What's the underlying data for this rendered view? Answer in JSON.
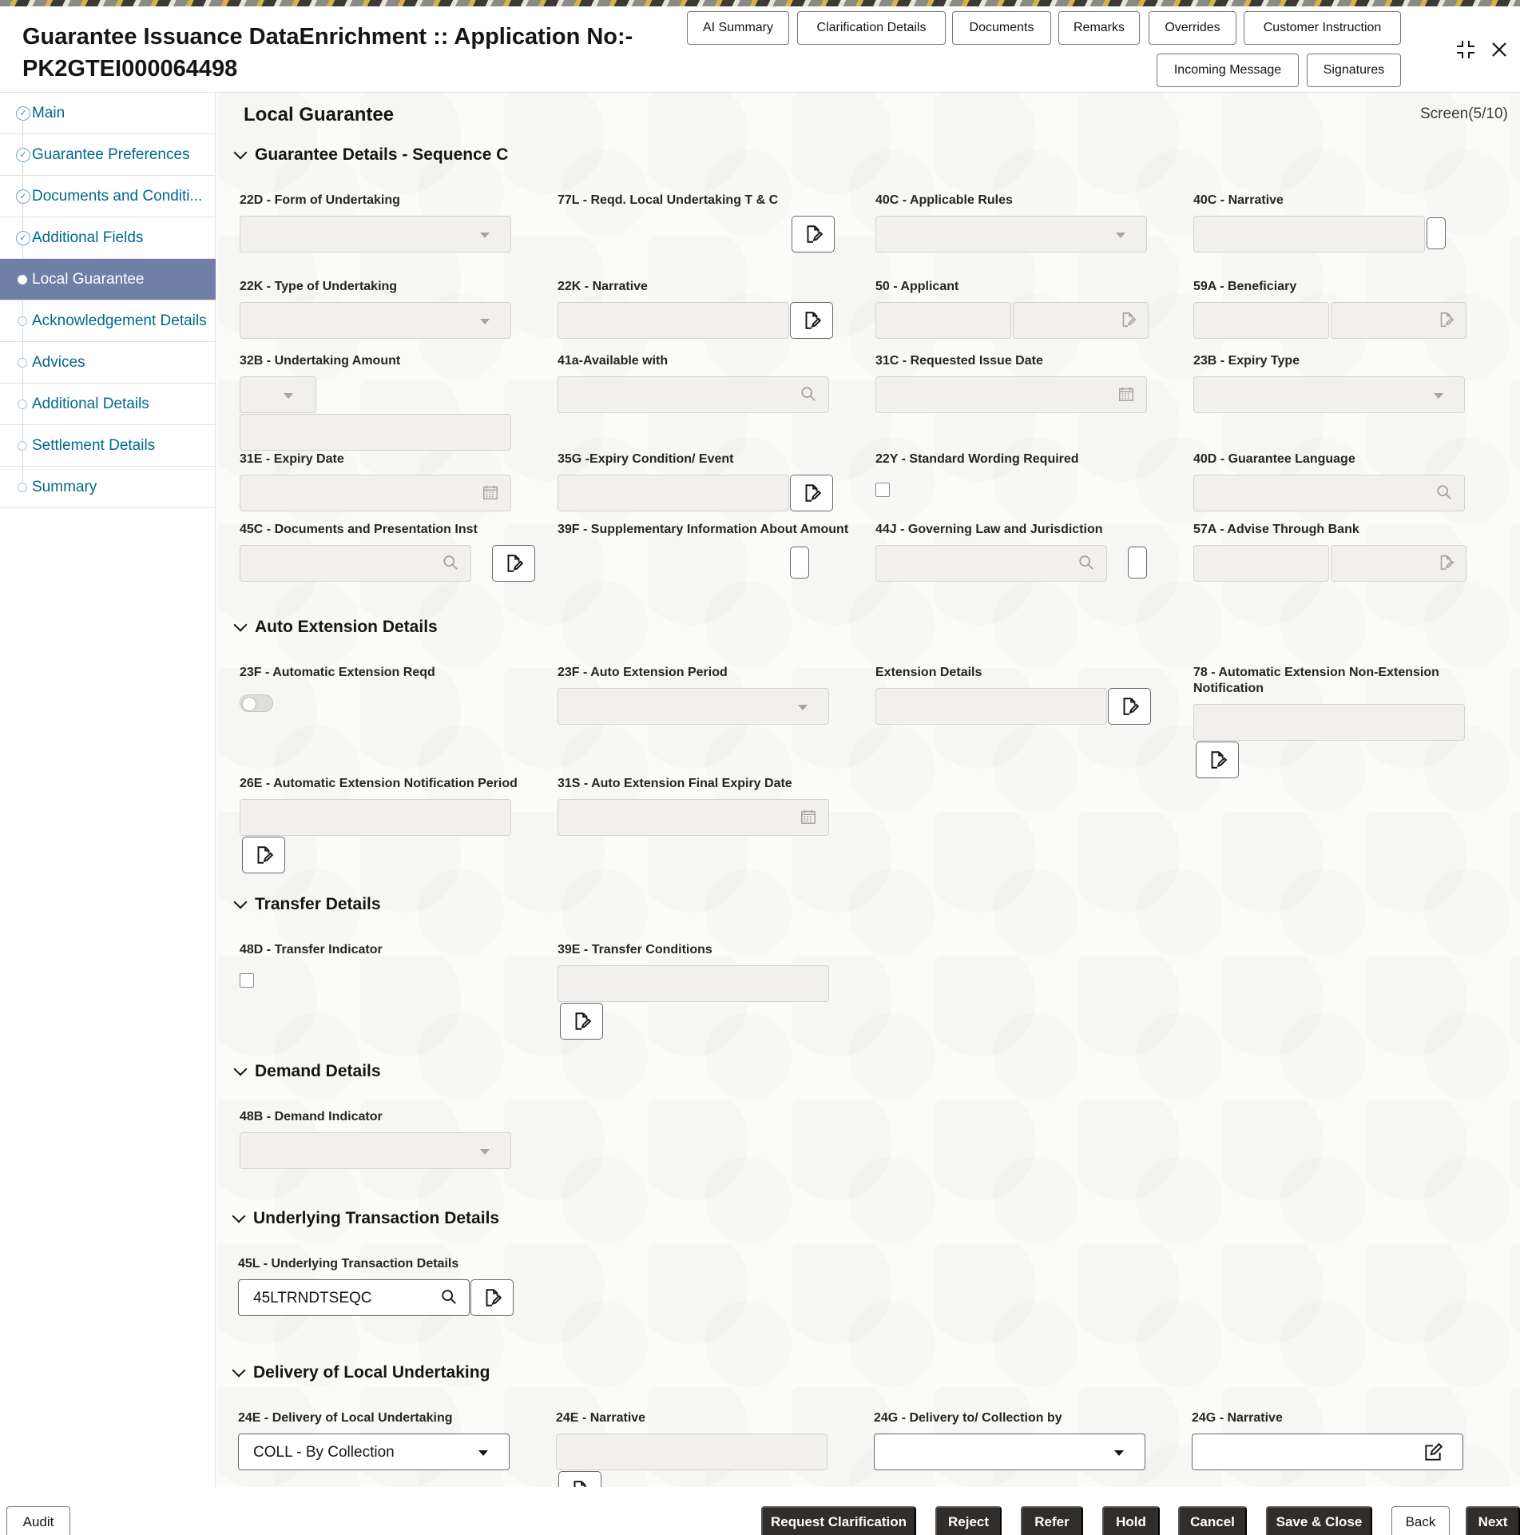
{
  "header": {
    "title": "Guarantee Issuance DataEnrichment :: Application No:- PK2GTEI000064498",
    "buttons": [
      "AI Summary",
      "Clarification Details",
      "Documents",
      "Remarks",
      "Overrides",
      "Customer Instruction",
      "Incoming Message",
      "Signatures"
    ],
    "icons": [
      "minimize-icon",
      "close-icon"
    ]
  },
  "sidebar": {
    "items": [
      {
        "label": "Main",
        "status": "done"
      },
      {
        "label": "Guarantee Preferences",
        "status": "done"
      },
      {
        "label": "Documents and Conditi...",
        "status": "done"
      },
      {
        "label": "Additional Fields",
        "status": "done"
      },
      {
        "label": "Local Guarantee",
        "status": "active"
      },
      {
        "label": "Acknowledgement Details",
        "status": "pending"
      },
      {
        "label": "Advices",
        "status": "pending"
      },
      {
        "label": "Additional Details",
        "status": "pending"
      },
      {
        "label": "Settlement Details",
        "status": "pending"
      },
      {
        "label": "Summary",
        "status": "pending"
      }
    ]
  },
  "main": {
    "page_title": "Local Guarantee",
    "screen_indicator": "Screen(5/10)",
    "sections": {
      "guarantee_details": {
        "title": "Guarantee Details - Sequence C",
        "labels": {
          "f22d": "22D - Form of Undertaking",
          "f77l": "77L - Reqd. Local Undertaking T & C",
          "f40c_rules": "40C - Applicable Rules",
          "f40c_narr": "40C - Narrative",
          "f22k": "22K - Type of Undertaking",
          "f22k_narr": "22K - Narrative",
          "f50": "50 - Applicant",
          "f59a": "59A - Beneficiary",
          "f32b": "32B - Undertaking Amount",
          "f41a": "41a-Available with",
          "f31c": "31C - Requested Issue Date",
          "f23b": "23B - Expiry Type",
          "f31e": "31E - Expiry Date",
          "f35g": "35G -Expiry Condition/ Event",
          "f22y": "22Y - Standard Wording Required",
          "f40d": "40D - Guarantee Language",
          "f45c": "45C - Documents and Presentation Inst",
          "f39f": "39F - Supplementary Information About Amount",
          "f44j": "44J - Governing Law and Jurisdiction",
          "f57a": "57A - Advise Through Bank"
        }
      },
      "auto_extension": {
        "title": "Auto Extension Details",
        "labels": {
          "f23f_reqd": "23F - Automatic Extension Reqd",
          "f23f_period": "23F - Auto Extension Period",
          "ext_details": "Extension Details",
          "f78": "78 - Automatic Extension Non-Extension Notification",
          "f26e": "26E - Automatic Extension Notification Period",
          "f31s": "31S - Auto Extension Final Expiry Date"
        }
      },
      "transfer": {
        "title": "Transfer Details",
        "labels": {
          "f48d": "48D - Transfer Indicator",
          "f39e": "39E - Transfer Conditions"
        }
      },
      "demand": {
        "title": "Demand Details",
        "labels": {
          "f48b": "48B - Demand Indicator"
        }
      },
      "underlying": {
        "title": "Underlying Transaction Details",
        "labels": {
          "f45l": "45L - Underlying Transaction Details"
        },
        "values": {
          "f45l": "45LTRNDTSEQC"
        }
      },
      "delivery": {
        "title": "Delivery of Local Undertaking",
        "labels": {
          "f24e": "24E - Delivery of Local Undertaking",
          "f24e_narr": "24E - Narrative",
          "f24g": "24G - Delivery to/ Collection by",
          "f24g_narr": "24G - Narrative"
        },
        "values": {
          "f24e": "COLL - By Collection"
        }
      }
    }
  },
  "footer": {
    "audit": "Audit",
    "buttons": [
      "Request Clarification",
      "Reject",
      "Refer",
      "Hold",
      "Cancel",
      "Save & Close",
      "Back",
      "Next"
    ]
  },
  "colors": {
    "active_nav": "#6f7fa6",
    "link": "#00688c",
    "primary_button": "#312d2a"
  }
}
